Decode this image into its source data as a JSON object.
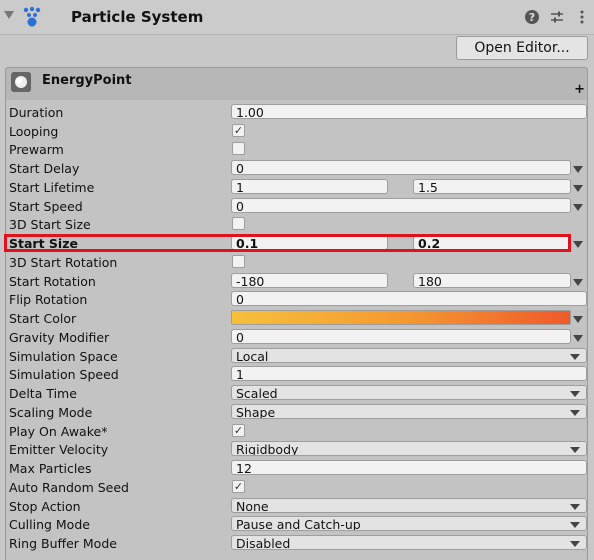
{
  "header": {
    "title": "Particle System",
    "open_editor_label": "Open Editor..."
  },
  "module": {
    "name": "EnergyPoint"
  },
  "rows": [
    {
      "label": "Duration",
      "value": "1.00"
    },
    {
      "label": "Looping",
      "checked": true
    },
    {
      "label": "Prewarm",
      "checked": false
    },
    {
      "label": "Start Delay",
      "value": "0"
    },
    {
      "label": "Start Lifetime",
      "min": "1",
      "max": "1.5"
    },
    {
      "label": "Start Speed",
      "value": "0"
    },
    {
      "label": "3D Start Size",
      "checked": false
    },
    {
      "label": "Start Size",
      "min": "0.1",
      "max": "0.2"
    },
    {
      "label": "3D Start Rotation",
      "checked": false
    },
    {
      "label": "Start Rotation",
      "min": "-180",
      "max": "180"
    },
    {
      "label": "Flip Rotation",
      "value": "0"
    },
    {
      "label": "Start Color",
      "gradient": [
        "#f6c03a",
        "#f59a30",
        "#ef5a2a"
      ]
    },
    {
      "label": "Gravity Modifier",
      "value": "0"
    },
    {
      "label": "Simulation Space",
      "value": "Local"
    },
    {
      "label": "Simulation Speed",
      "value": "1"
    },
    {
      "label": "Delta Time",
      "value": "Scaled"
    },
    {
      "label": "Scaling Mode",
      "value": "Shape"
    },
    {
      "label": "Play On Awake*",
      "checked": true
    },
    {
      "label": "Emitter Velocity",
      "value": "Rigidbody"
    },
    {
      "label": "Max Particles",
      "value": "12"
    },
    {
      "label": "Auto Random Seed",
      "checked": true
    },
    {
      "label": "Stop Action",
      "value": "None"
    },
    {
      "label": "Culling Mode",
      "value": "Pause and Catch-up"
    },
    {
      "label": "Ring Buffer Mode",
      "value": "Disabled"
    }
  ],
  "highlight_color": "#e0121c"
}
